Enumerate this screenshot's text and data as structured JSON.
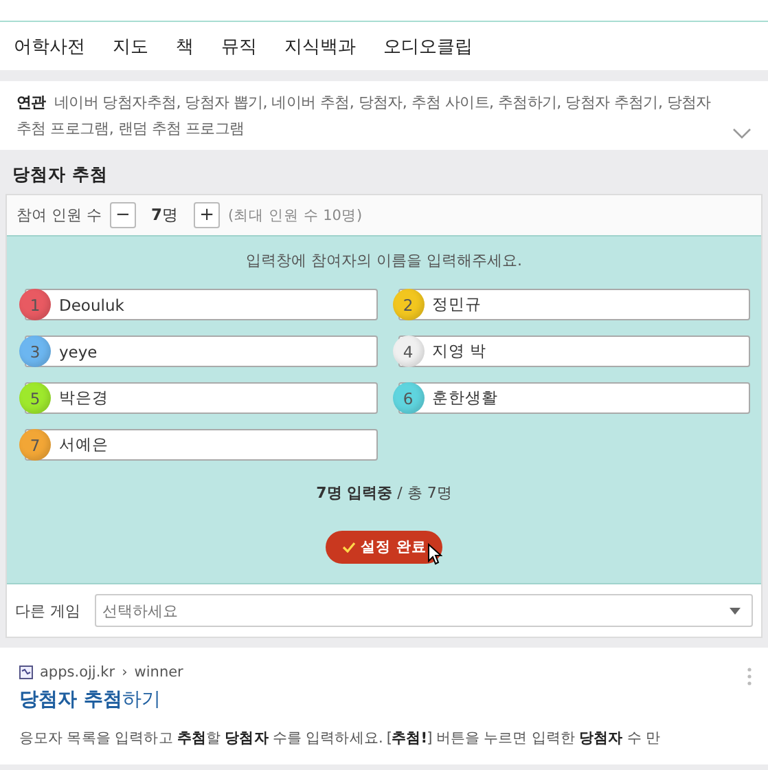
{
  "nav": {
    "tabs": [
      {
        "label": "어학사전"
      },
      {
        "label": "지도"
      },
      {
        "label": "책"
      },
      {
        "label": "뮤직"
      },
      {
        "label": "지식백과"
      },
      {
        "label": "오디오클립"
      }
    ]
  },
  "related": {
    "label": "연관",
    "text": "네이버 당첨자추첨, 당첨자 뽑기, 네이버 추첨, 당첨자, 추첨 사이트, 추첨하기, 당첨자 추첨기, 당첨자 추첨 프로그램, 랜덤 추첨 프로그램",
    "expanded": false
  },
  "widget": {
    "title": "당첨자 추첨",
    "counter": {
      "label": "참여 인원 수",
      "minus": "−",
      "value": "**7**명",
      "plus": "+",
      "max_note": "(최대 인원 수 10명)"
    },
    "instruction": "입력창에 참여자의 이름을 입력해주세요.",
    "participants": [
      {
        "number": "1",
        "name": "Deouluk",
        "color": "#e85a62"
      },
      {
        "number": "2",
        "name": "정민규",
        "color": "#f2c61f"
      },
      {
        "number": "3",
        "name": "yeye",
        "color": "#6cb6f0"
      },
      {
        "number": "4",
        "name": "지영 박",
        "color": "#f0f0f0"
      },
      {
        "number": "5",
        "name": "박은경",
        "color": "#9ee82c"
      },
      {
        "number": "6",
        "name": "훈한생활",
        "color": "#5fd4de"
      },
      {
        "number": "7",
        "name": "서예은",
        "color": "#f2a636"
      }
    ],
    "summary": "**7명 입력중** / 총 7명",
    "confirm_button": "설정 완료",
    "other_game": {
      "label": "다른 게임",
      "placeholder": "선택하세요"
    }
  },
  "result": {
    "site": "apps.ojj.kr",
    "separator": "›",
    "path": "winner",
    "title": "**당첨자 추첨**하기",
    "snippet": "응모자 목록을 입력하고 **추첨**할 **당첨자** 수를 입력하세요. [**추첨!**] 버튼을 누르면 입력한 **당첨자** 수 만"
  }
}
